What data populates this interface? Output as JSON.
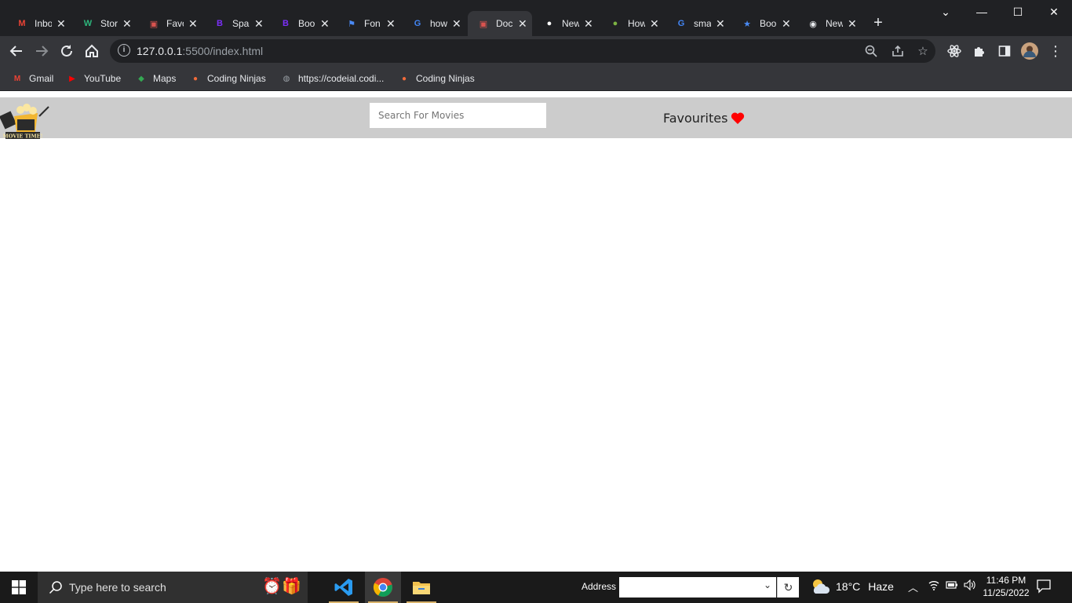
{
  "browser": {
    "tabs": [
      {
        "title": "Inbox",
        "icon": "gmail-icon",
        "fav_color": "#ea4335",
        "fav_glyph": "M"
      },
      {
        "title": "Stor",
        "icon": "wix-icon",
        "fav_color": "#2db67c",
        "fav_glyph": "W"
      },
      {
        "title": "Favo",
        "icon": "movie-app-icon",
        "fav_color": "#d9534f",
        "fav_glyph": "▣"
      },
      {
        "title": "Spa",
        "icon": "bootstrap-icon",
        "fav_color": "#7b2ff7",
        "fav_glyph": "B"
      },
      {
        "title": "Boo",
        "icon": "bootstrap-icon",
        "fav_color": "#7b2ff7",
        "fav_glyph": "B"
      },
      {
        "title": "Fon",
        "icon": "flag-icon",
        "fav_color": "#4a8af4",
        "fav_glyph": "⚑"
      },
      {
        "title": "how",
        "icon": "google-icon",
        "fav_color": "#4285f4",
        "fav_glyph": "G"
      },
      {
        "title": "Doc",
        "icon": "movie-app-icon",
        "fav_color": "#d9534f",
        "fav_glyph": "▣"
      },
      {
        "title": "New",
        "icon": "github-icon",
        "fav_color": "#ffffff",
        "fav_glyph": "●"
      },
      {
        "title": "How",
        "icon": "site-icon",
        "fav_color": "#7cb342",
        "fav_glyph": "●"
      },
      {
        "title": "sma",
        "icon": "google-icon",
        "fav_color": "#4285f4",
        "fav_glyph": "G"
      },
      {
        "title": "Boo",
        "icon": "star-icon",
        "fav_color": "#4a8af4",
        "fav_glyph": "★"
      },
      {
        "title": "New",
        "icon": "chrome-icon",
        "fav_color": "#e8eaed",
        "fav_glyph": "◉"
      }
    ],
    "active_tab_index": 7,
    "url_host": "127.0.0.1",
    "url_rest": ":5500/index.html",
    "bookmarks": [
      {
        "label": "Gmail",
        "icon": "gmail-icon",
        "color": "#ea4335",
        "glyph": "M"
      },
      {
        "label": "YouTube",
        "icon": "youtube-icon",
        "color": "#ff0000",
        "glyph": "▶"
      },
      {
        "label": "Maps",
        "icon": "maps-icon",
        "color": "#34a853",
        "glyph": "◆"
      },
      {
        "label": "Coding Ninjas",
        "icon": "coding-ninjas-icon",
        "color": "#f26b3a",
        "glyph": "●"
      },
      {
        "label": "https://codeial.codi...",
        "icon": "globe-icon",
        "color": "#9aa0a6",
        "glyph": "◍"
      },
      {
        "label": "Coding Ninjas",
        "icon": "coding-ninjas-icon",
        "color": "#f26b3a",
        "glyph": "●"
      }
    ]
  },
  "page": {
    "logo_text": "MOVIE TIME!",
    "search_placeholder": "Search For Movies",
    "search_value": "",
    "favourites_label": "Favourites"
  },
  "taskbar": {
    "search_placeholder": "Type here to search",
    "address_label": "Address",
    "address_value": "",
    "temperature": "18°C",
    "weather": "Haze",
    "time": "11:46 PM",
    "date": "11/25/2022"
  }
}
